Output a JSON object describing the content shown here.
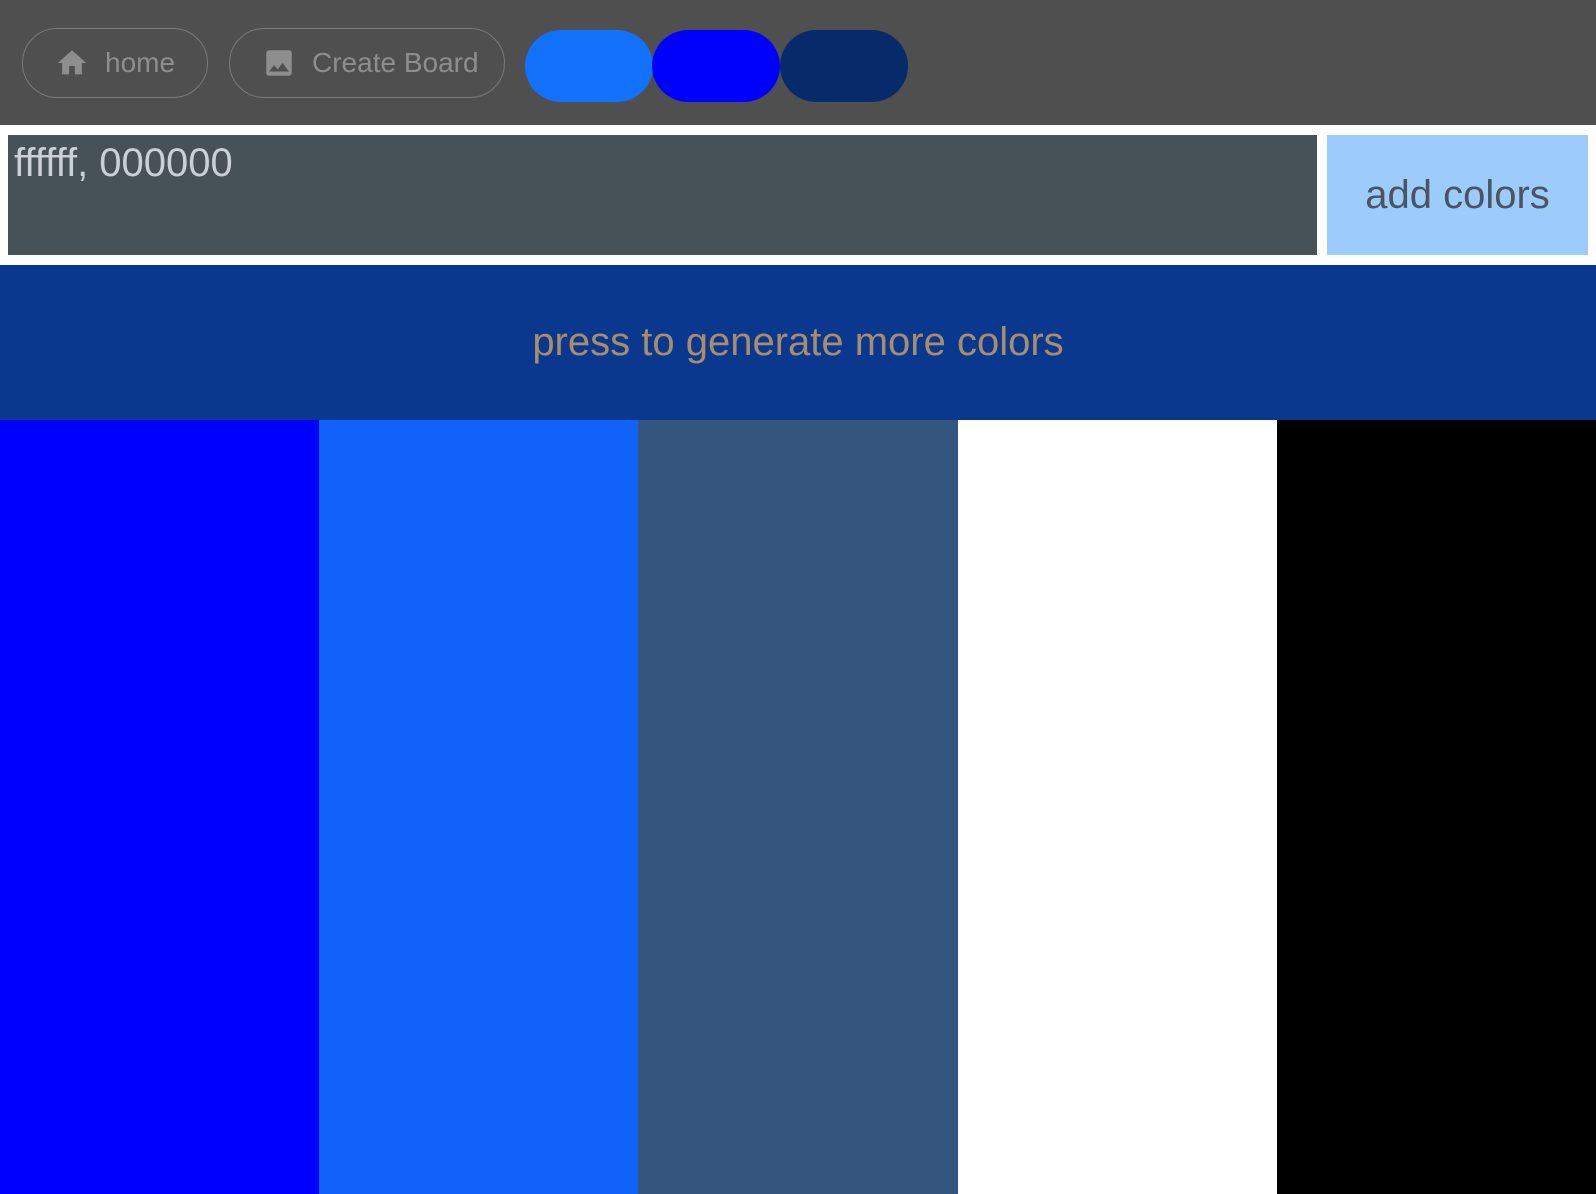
{
  "nav": {
    "home_label": "home",
    "create_board_label": "Create Board",
    "home_icon": "home-icon",
    "create_board_icon": "image-icon"
  },
  "palette_pills": [
    {
      "color": "#1272fc"
    },
    {
      "color": "#0000fd"
    },
    {
      "color": "#072a6a"
    }
  ],
  "color_input": {
    "value": "ffffff, 000000"
  },
  "add_button": {
    "label": "add colors"
  },
  "generate_bar": {
    "label": "press to generate more colors",
    "background": "#0b388f",
    "text_color": "#a88d6b"
  },
  "swatches": [
    {
      "color": "#0000ff"
    },
    {
      "color": "#1062fa"
    },
    {
      "color": "#34557e"
    },
    {
      "color": "#ffffff"
    },
    {
      "color": "#000000"
    }
  ]
}
